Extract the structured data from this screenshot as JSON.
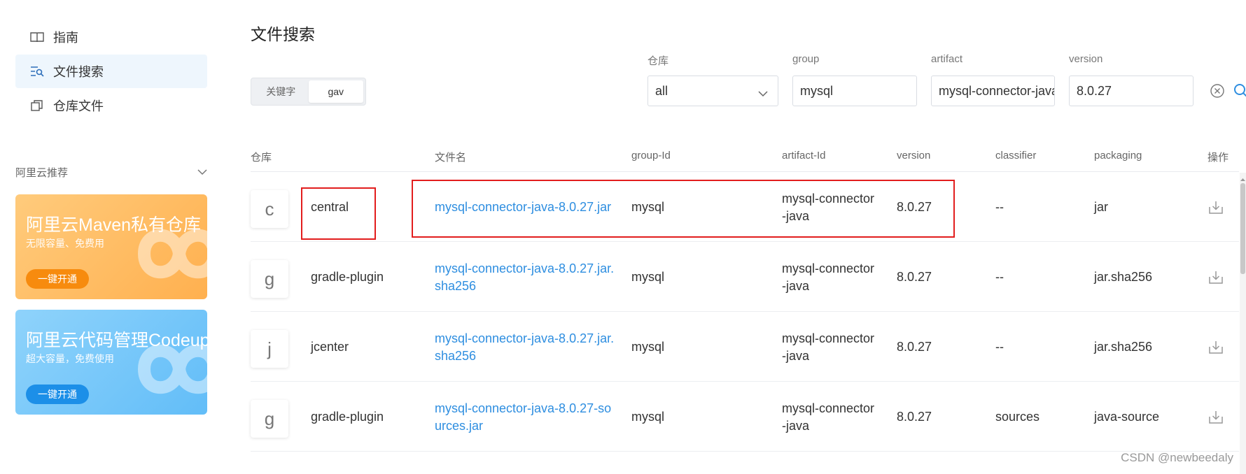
{
  "sidebar": {
    "items": [
      {
        "label": "指南",
        "icon": "book-icon"
      },
      {
        "label": "文件搜索",
        "icon": "search-list-icon",
        "active": true
      },
      {
        "label": "仓库文件",
        "icon": "copy-icon"
      }
    ],
    "recommend_label": "阿里云推荐",
    "promos": [
      {
        "title": "阿里云Maven私有仓库",
        "subtitle": "无限容量、免费用",
        "button": "一键开通"
      },
      {
        "title": "阿里云代码管理Codeup",
        "subtitle": "超大容量，免费使用",
        "button": "一键开通"
      }
    ]
  },
  "main": {
    "title": "文件搜索",
    "mode_toggle": {
      "options": [
        "关键字",
        "gav"
      ],
      "selected": "gav"
    },
    "filters": {
      "repo": {
        "label": "仓库",
        "value": "all"
      },
      "group": {
        "label": "group",
        "value": "mysql"
      },
      "artifact": {
        "label": "artifact",
        "value": "mysql-connector-java"
      },
      "version": {
        "label": "version",
        "value": "8.0.27"
      }
    },
    "table": {
      "headers": [
        "仓库",
        "文件名",
        "group-Id",
        "artifact-Id",
        "version",
        "classifier",
        "packaging",
        "操作"
      ],
      "rows": [
        {
          "badge": "c",
          "repo": "central",
          "file_line1": "mysql-connector-java-8.0.27.jar",
          "file_line2": "",
          "group_id": "mysql",
          "artifact_line1": "mysql-connector",
          "artifact_line2": "-java",
          "version": "8.0.27",
          "classifier": "--",
          "packaging": "jar"
        },
        {
          "badge": "g",
          "repo": "gradle-plugin",
          "file_line1": "mysql-connector-java-8.0.27.jar.",
          "file_line2": "sha256",
          "group_id": "mysql",
          "artifact_line1": "mysql-connector",
          "artifact_line2": "-java",
          "version": "8.0.27",
          "classifier": "--",
          "packaging": "jar.sha256"
        },
        {
          "badge": "j",
          "repo": "jcenter",
          "file_line1": "mysql-connector-java-8.0.27.jar.",
          "file_line2": "sha256",
          "group_id": "mysql",
          "artifact_line1": "mysql-connector",
          "artifact_line2": "-java",
          "version": "8.0.27",
          "classifier": "--",
          "packaging": "jar.sha256"
        },
        {
          "badge": "g",
          "repo": "gradle-plugin",
          "file_line1": "mysql-connector-java-8.0.27-so",
          "file_line2": "urces.jar",
          "group_id": "mysql",
          "artifact_line1": "mysql-connector",
          "artifact_line2": "-java",
          "version": "8.0.27",
          "classifier": "sources",
          "packaging": "java-source"
        }
      ]
    }
  },
  "watermark": "CSDN @newbeedaly",
  "colors": {
    "accent": "#2e8ee0",
    "highlight_box": "#e21d1d",
    "active_nav_bg": "#eef6fd"
  }
}
